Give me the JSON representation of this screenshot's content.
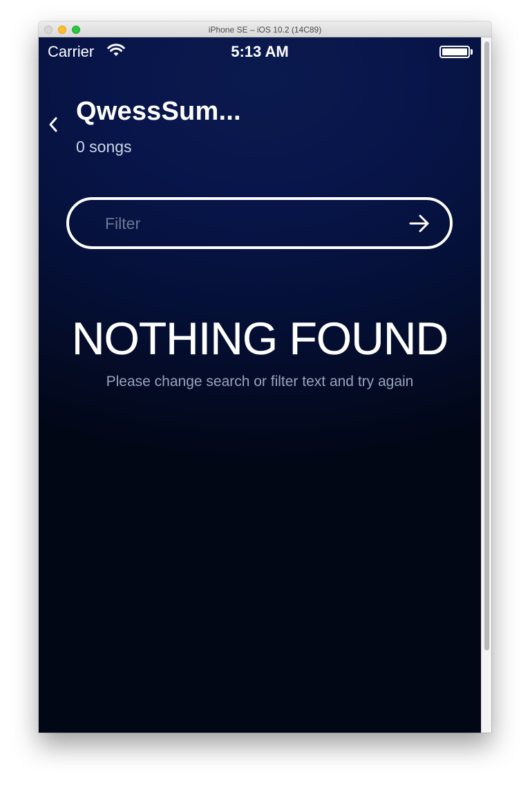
{
  "window": {
    "title": "iPhone SE – iOS 10.2 (14C89)"
  },
  "status_bar": {
    "carrier": "Carrier",
    "time": "5:13 AM",
    "wifi_icon": "wifi-icon",
    "battery_icon": "battery-icon"
  },
  "header": {
    "back_icon": "chevron-left-icon",
    "title": "QwessSum...",
    "subtitle": "0 songs"
  },
  "filter": {
    "placeholder": "Filter",
    "value": "",
    "submit_icon": "arrow-right-icon"
  },
  "empty_state": {
    "title": "NOTHING FOUND",
    "message": "Please change search or filter text and try again"
  },
  "colors": {
    "background_top": "#0b1a4e",
    "background_bottom": "#020716",
    "text": "#ffffff",
    "muted_text": "#9aa2bd"
  }
}
